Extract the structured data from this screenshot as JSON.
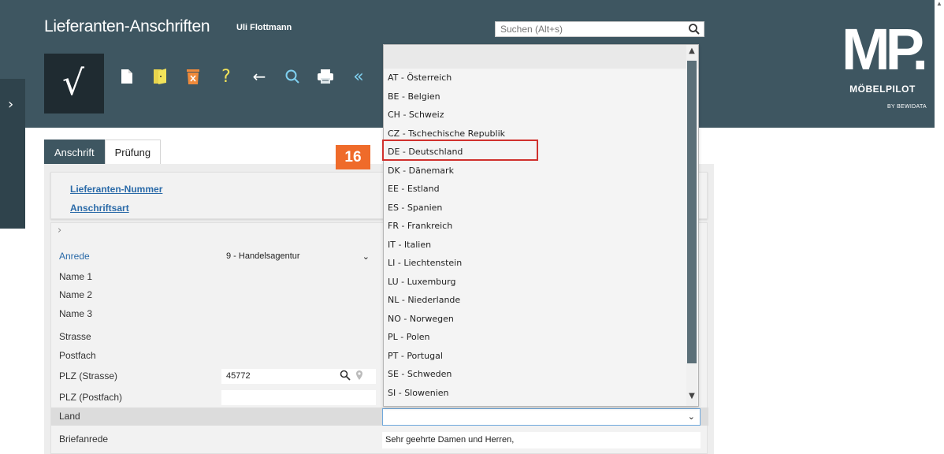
{
  "window": {
    "title": "Lieferanten-Anschriften",
    "user": "Uli Flottmann"
  },
  "search": {
    "placeholder": "Suchen (Alt+s)"
  },
  "logo": {
    "mark": "MP.",
    "brand": "MÖBELPILOT",
    "by": "BY BEWIDATA"
  },
  "toolbar": {
    "confirm_glyph": "√"
  },
  "tabs": [
    {
      "label": "Anschrift",
      "active": true
    },
    {
      "label": "Prüfung",
      "active": false
    }
  ],
  "links": {
    "lieferanten_nummer": "Lieferanten-Nummer",
    "anschriftsart": "Anschriftsart"
  },
  "form": {
    "anrede_label": "Anrede",
    "anrede_value": "9 - Handelsagentur",
    "name1_label": "Name 1",
    "name2_label": "Name 2",
    "name3_label": "Name 3",
    "strasse_label": "Strasse",
    "postfach_label": "Postfach",
    "plz_strasse_label": "PLZ (Strasse)",
    "plz_strasse_value": "45772",
    "plz_postfach_label": "PLZ (Postfach)",
    "land_label": "Land",
    "briefanrede_label": "Briefanrede",
    "briefanrede_value": "Sehr geehrte Damen und Herren,"
  },
  "dropdown": {
    "options": [
      "AT - Österreich",
      "BE - Belgien",
      "CH - Schweiz",
      "CZ - Tschechische Republik",
      "DE - Deutschland",
      "DK - Dänemark",
      "EE - Estland",
      "ES - Spanien",
      "FR - Frankreich",
      "IT - Italien",
      "LI - Liechtenstein",
      "LU - Luxemburg",
      "NL - Niederlande",
      "NO - Norwegen",
      "PL - Polen",
      "PT - Portugal",
      "SE - Schweden",
      "SI - Slowenien"
    ],
    "highlighted": "DE - Deutschland"
  },
  "annotation": {
    "step": "16"
  },
  "colors": {
    "header": "#3e5661",
    "accent_link": "#2a6aa8",
    "badge": "#ef6b2a",
    "highlight": "#d0312d"
  }
}
